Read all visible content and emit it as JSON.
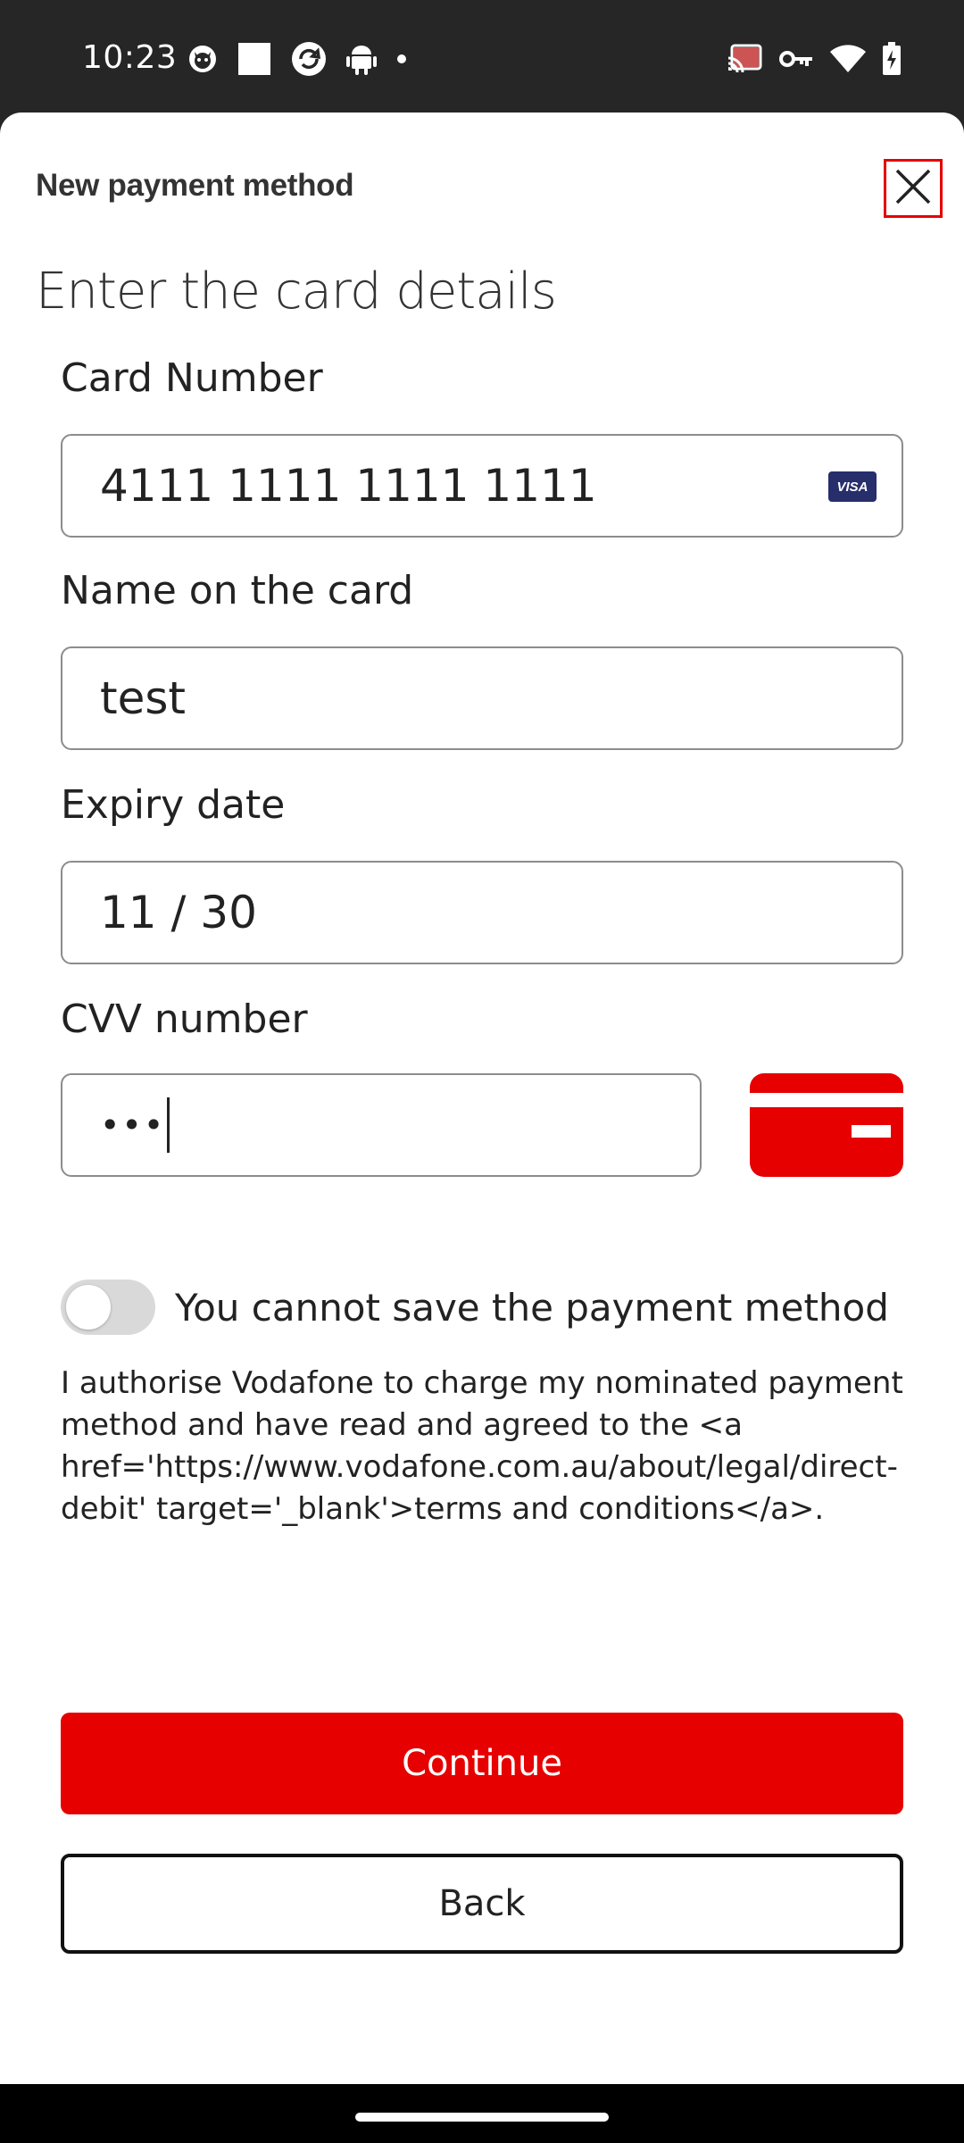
{
  "status_bar": {
    "time": "10:23",
    "left_icons": [
      "cat-face-icon",
      "white-square-icon",
      "sync-circle-icon",
      "android-icon",
      "dot-icon"
    ],
    "right_icons": [
      "cast-icon",
      "vpn-key-icon",
      "wifi-icon",
      "battery-charging-icon"
    ]
  },
  "sheet": {
    "title": "New payment method",
    "close_icon": "close-icon",
    "heading": "Enter the card details"
  },
  "form": {
    "card_number": {
      "label": "Card Number",
      "value": "4111 1111 1111 1111",
      "brand": "VISA"
    },
    "name": {
      "label": "Name on the card",
      "value": "test"
    },
    "expiry": {
      "label": "Expiry date",
      "value": "11 / 30"
    },
    "cvv": {
      "label": "CVV number",
      "value": "•••",
      "help_icon": "card-back-icon"
    }
  },
  "save_toggle": {
    "label": "You cannot save the payment method",
    "checked": false
  },
  "consent_text": "I authorise Vodafone to charge my nominated payment method and have read and agreed to the <a href='https://www.vodafone.com.au/about/legal/direct-debit' target='_blank'>terms and conditions</a>.",
  "actions": {
    "continue_label": "Continue",
    "back_label": "Back"
  },
  "colors": {
    "brand_red": "#e60000",
    "status_bar_bg": "#262626",
    "visa_navy": "#262e6b"
  }
}
